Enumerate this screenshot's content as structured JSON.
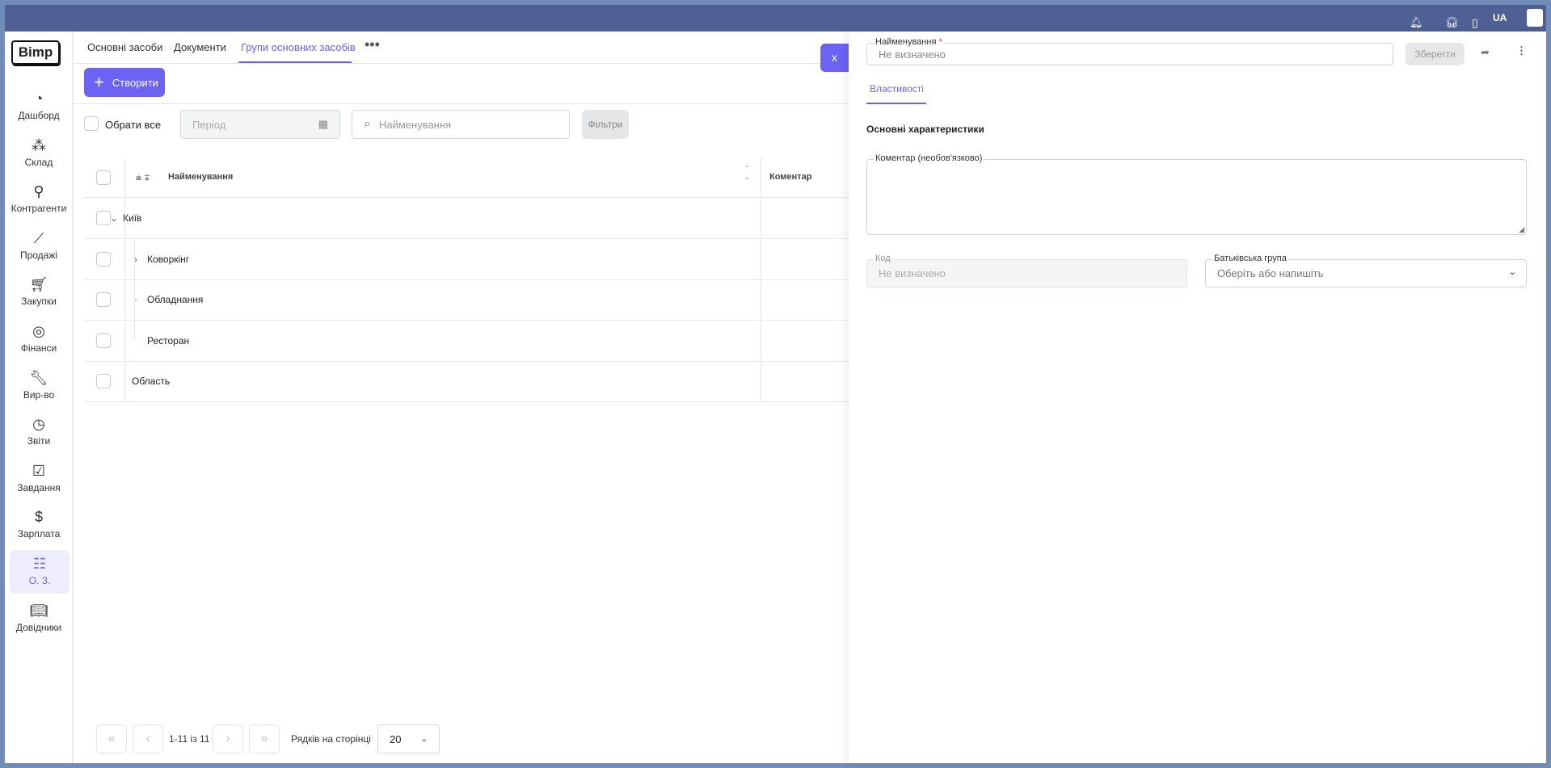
{
  "topbar": {
    "language": "UA",
    "icons": [
      "bell-icon",
      "headset-icon",
      "book-icon",
      "avatar"
    ]
  },
  "sidebar": {
    "logo": "Bimp",
    "items": [
      {
        "label": "Дашборд",
        "icon": "gauge-icon"
      },
      {
        "label": "Склад",
        "icon": "boxes-icon"
      },
      {
        "label": "Контрагенти",
        "icon": "network-icon"
      },
      {
        "label": "Продажі",
        "icon": "chart-line-icon"
      },
      {
        "label": "Закупки",
        "icon": "cart-icon"
      },
      {
        "label": "Фінанси",
        "icon": "coins-icon"
      },
      {
        "label": "Вир-во",
        "icon": "wrench-icon"
      },
      {
        "label": "Звіти",
        "icon": "pie-icon"
      },
      {
        "label": "Завдання",
        "icon": "tasks-icon"
      },
      {
        "label": "Зарплата",
        "icon": "dollar-icon"
      },
      {
        "label": "О. З.",
        "icon": "list-icon",
        "active": true
      },
      {
        "label": "Довідники",
        "icon": "book-open-icon"
      }
    ]
  },
  "tabs": [
    "Основні засоби",
    "Документи",
    "Групи основних засобів"
  ],
  "create_label": "Створити",
  "filters": {
    "select_all": "Обрати все",
    "period_placeholder": "Період",
    "search_placeholder": "Найменування",
    "filters_label": "Фільтри"
  },
  "table": {
    "columns": [
      "Найменування",
      "Коментар"
    ],
    "rows": [
      {
        "name": "Київ",
        "comment": ""
      },
      {
        "name": "Коворкінг",
        "comment": ""
      },
      {
        "name": "Обладнання",
        "comment": ""
      },
      {
        "name": "Ресторан",
        "comment": ""
      },
      {
        "name": "Область",
        "comment": ""
      }
    ]
  },
  "pagination": {
    "range": "1-11 із 11",
    "rows_label": "Рядків на сторінці",
    "rows_value": "20"
  },
  "panel": {
    "name_label": "Найменування",
    "required_mark": "*",
    "name_placeholder": "Не визначено",
    "save_label": "Зберегти",
    "close_label": "x",
    "tab": "Властивості",
    "section": "Основні характеристики",
    "comment_label": "Коментар (необов'язково)",
    "code_label": "Код",
    "code_placeholder": "Не визначено",
    "parent_label": "Батьківська група",
    "parent_placeholder": "Оберіть або напишіть"
  },
  "colors": {
    "accent": "#6c63f5",
    "topbar": "#4e6094"
  }
}
